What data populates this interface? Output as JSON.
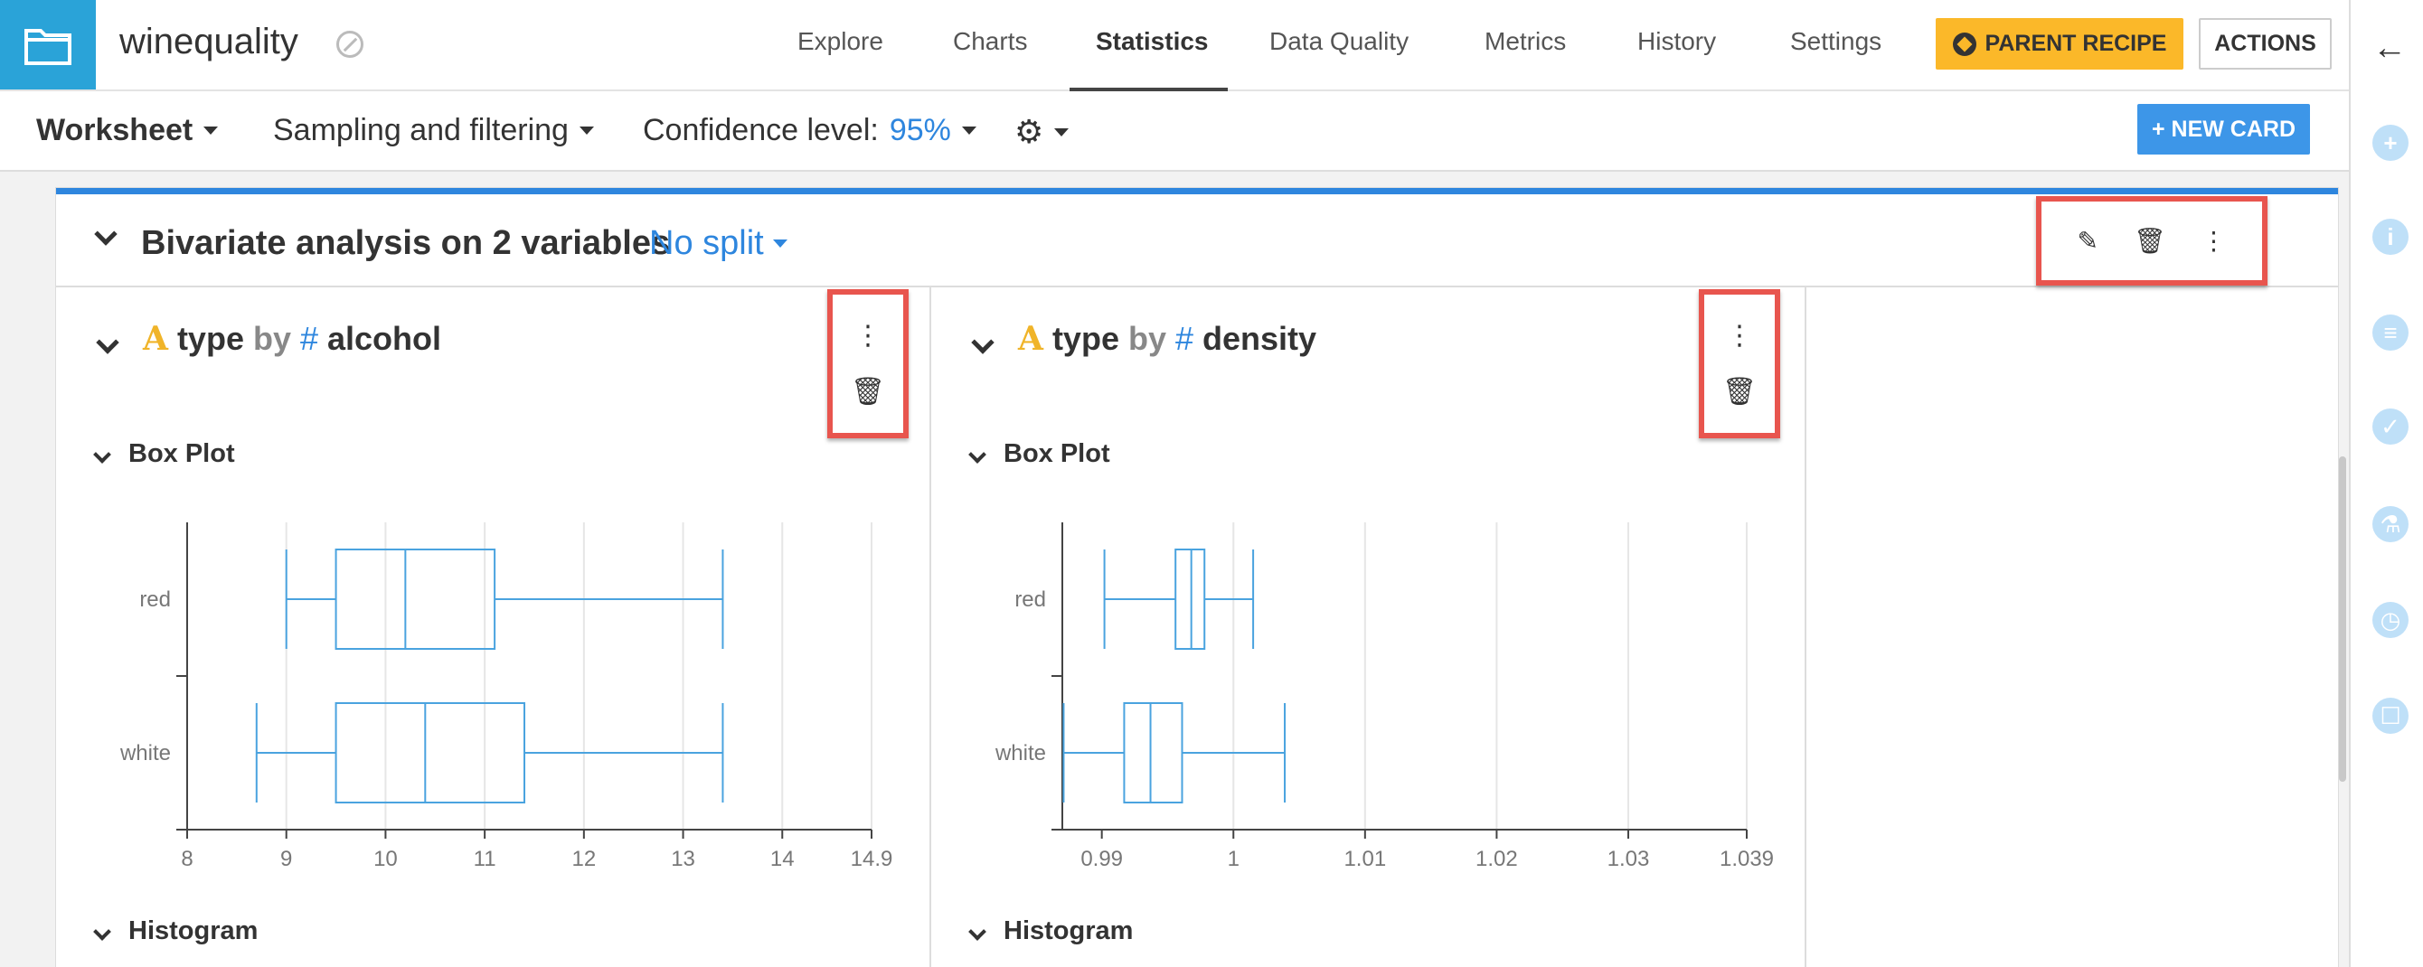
{
  "app": {
    "project_name": "winequality",
    "nav_tabs": [
      "Explore",
      "Charts",
      "Statistics",
      "Data Quality",
      "Metrics",
      "History",
      "Settings"
    ],
    "active_tab": "Statistics",
    "parent_recipe_label": "PARENT RECIPE",
    "actions_label": "ACTIONS",
    "accent_color": "#2e86de",
    "highlight_color": "#e8554e"
  },
  "toolbar": {
    "worksheet_label": "Worksheet",
    "sampling_label": "Sampling and filtering",
    "confidence_label": "Confidence level:",
    "confidence_value": "95%",
    "new_card_label": "+ NEW CARD"
  },
  "card": {
    "title": "Bivariate analysis on 2 variables",
    "split_label": "No split",
    "panels": [
      {
        "var_a": "type",
        "by": "by",
        "var_b": "alcohol",
        "box_plot_label": "Box Plot",
        "histogram_label": "Histogram"
      },
      {
        "var_a": "type",
        "by": "by",
        "var_b": "density",
        "box_plot_label": "Box Plot",
        "histogram_label": "Histogram"
      }
    ]
  },
  "chart_data": [
    {
      "type": "boxplot",
      "orientation": "horizontal",
      "categories": [
        "red",
        "white"
      ],
      "x_ticks": [
        "8",
        "9",
        "10",
        "11",
        "12",
        "13",
        "14",
        "14.9"
      ],
      "xlim": [
        8,
        14.9
      ],
      "grid": true,
      "series": [
        {
          "name": "red",
          "min": 9.0,
          "q1": 9.5,
          "median": 10.2,
          "q3": 11.1,
          "max": 13.4
        },
        {
          "name": "white",
          "min": 8.7,
          "q1": 9.5,
          "median": 10.4,
          "q3": 11.4,
          "max": 13.4
        }
      ]
    },
    {
      "type": "boxplot",
      "orientation": "horizontal",
      "categories": [
        "red",
        "white"
      ],
      "x_ticks": [
        "0.99",
        "1",
        "1.01",
        "1.02",
        "1.03",
        "1.039"
      ],
      "xlim": [
        0.987,
        1.039
      ],
      "grid": true,
      "series": [
        {
          "name": "red",
          "min": 0.9902,
          "q1": 0.9956,
          "median": 0.9968,
          "q3": 0.9978,
          "max": 1.0015
        },
        {
          "name": "white",
          "min": 0.9871,
          "q1": 0.9917,
          "median": 0.9937,
          "q3": 0.9961,
          "max": 1.0039
        }
      ]
    }
  ],
  "icons": {
    "folder": "folder-icon",
    "pencil": "pencil-icon",
    "trash": "trash-icon",
    "dots": "kebab-icon",
    "gears": "gears-icon"
  }
}
